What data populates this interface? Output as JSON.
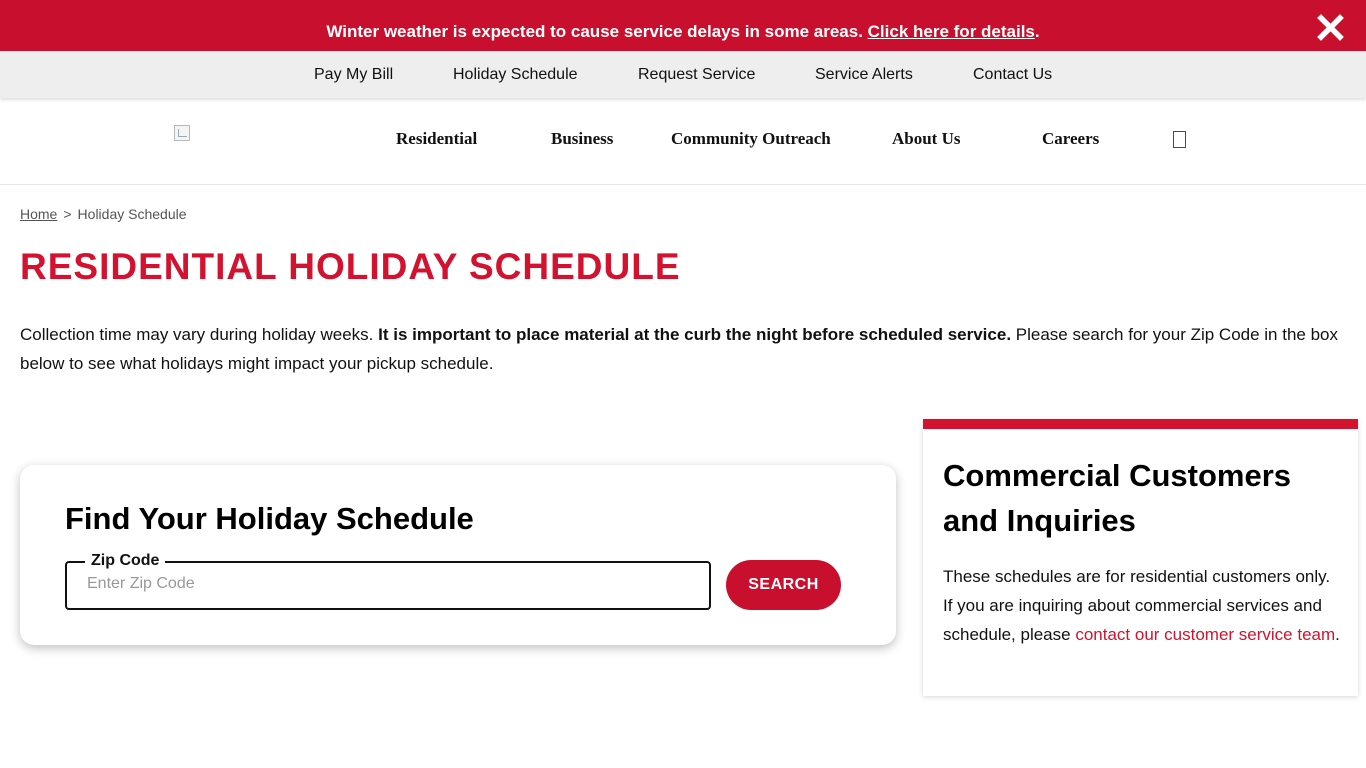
{
  "alert": {
    "message": "Winter weather is expected to cause service delays in some areas. ",
    "link_text": "Click here for details",
    "trailing": ".",
    "close_icon": "close-x-icon"
  },
  "utility_nav": {
    "items": [
      "Pay My Bill",
      "Holiday Schedule",
      "Request Service",
      "Service Alerts",
      "Contact Us"
    ]
  },
  "main_nav": {
    "logo_icon": "broken-image-icon",
    "items": [
      "Residential",
      "Business",
      "Community Outreach",
      "About Us",
      "Careers"
    ],
    "search_icon": "search-icon"
  },
  "breadcrumb": {
    "home": "Home",
    "separator": ">",
    "current": "Holiday Schedule"
  },
  "page": {
    "title": "RESIDENTIAL HOLIDAY SCHEDULE",
    "intro_start": "Collection time may vary during holiday weeks. ",
    "intro_bold": "It is important to place material at the curb the night before scheduled service.",
    "intro_end": " Please search for your Zip Code in the box below to see what holidays might impact your pickup schedule."
  },
  "finder": {
    "title": "Find Your Holiday Schedule",
    "zip_label": "Zip Code",
    "zip_placeholder": "Enter Zip Code",
    "zip_value": "",
    "search_label": "SEARCH"
  },
  "commercial": {
    "title": "Commercial Customers and Inquiries",
    "text_start": "These schedules are for residential customers only. If you are inquiring about commercial services and schedule, please ",
    "link_text": "contact our customer service team",
    "text_end": "."
  },
  "colors": {
    "brand_red": "#c8102e",
    "title_red": "#d2122e",
    "utility_bg": "#eeeeee"
  }
}
